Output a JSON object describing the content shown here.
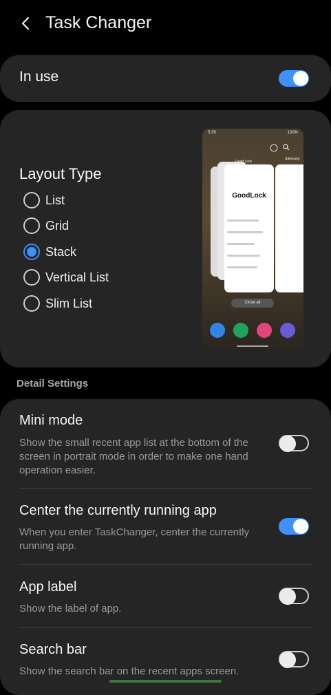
{
  "header": {
    "title": "Task Changer",
    "back_icon": "chevron-left-icon"
  },
  "in_use": {
    "label": "In use",
    "enabled": true
  },
  "layout": {
    "title": "Layout Type",
    "options": [
      {
        "label": "List",
        "selected": false
      },
      {
        "label": "Grid",
        "selected": false
      },
      {
        "label": "Stack",
        "selected": true
      },
      {
        "label": "Vertical List",
        "selected": false
      },
      {
        "label": "Slim List",
        "selected": false
      }
    ],
    "preview": {
      "time": "5:39",
      "battery": "100%",
      "app_main": "Good Lock",
      "app_main_logo": "GoodLock",
      "app_right": "Samsung",
      "close_all": "Close all"
    }
  },
  "detail_settings": {
    "section_label": "Detail Settings",
    "items": [
      {
        "title": "Mini mode",
        "desc": "Show the small recent app list at the bottom of the screen in portrait mode in order to make one hand operation easier.",
        "enabled": false
      },
      {
        "title": "Center the currently running app",
        "desc": "When you enter TaskChanger, center the currently running app.",
        "enabled": true
      },
      {
        "title": "App label",
        "desc": "Show the label of app.",
        "enabled": false
      },
      {
        "title": "Search bar",
        "desc": "Show the search bar on the recent apps screen.",
        "enabled": false
      }
    ]
  },
  "colors": {
    "accent": "#3e91f7",
    "card": "#252525",
    "background": "#000000"
  }
}
